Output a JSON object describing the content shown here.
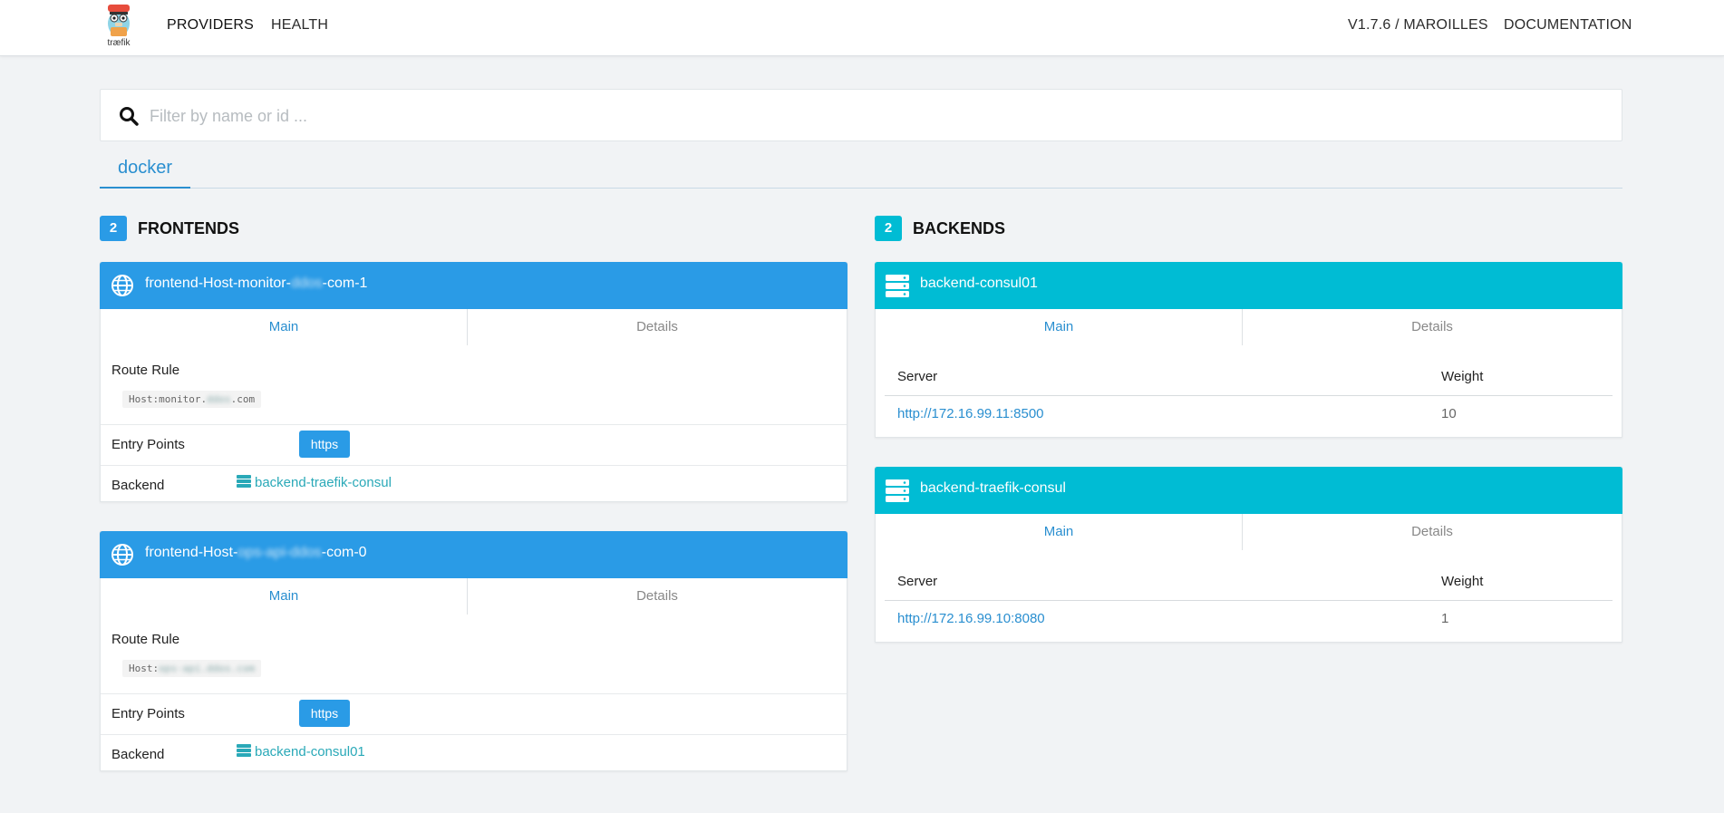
{
  "nav": {
    "logo_text": "træfik",
    "providers": "PROVIDERS",
    "health": "HEALTH",
    "version": "V1.7.6 / MAROILLES",
    "documentation": "DOCUMENTATION"
  },
  "search": {
    "placeholder": "Filter by name or id ...",
    "value": ""
  },
  "provider_tabs": [
    {
      "label": "docker"
    }
  ],
  "colors": {
    "frontend_header": "#2a9be6",
    "backend_header": "#00bcd4",
    "accent": "#2a8fd0"
  },
  "frontends": {
    "count": "2",
    "title": "FRONTENDS",
    "items": [
      {
        "name_prefix": "frontend-Host-monitor-",
        "name_masked": "ddos",
        "name_suffix": "-com-1",
        "tab_main": "Main",
        "tab_details": "Details",
        "route_rule_label": "Route Rule",
        "route_rule_prefix": "Host:monitor.",
        "route_rule_masked": "ddos",
        "route_rule_suffix": ".com",
        "entry_points_label": "Entry Points",
        "entry_point": "https",
        "backend_label": "Backend",
        "backend": "backend-traefik-consul"
      },
      {
        "name_prefix": "frontend-Host-",
        "name_masked": "ops-api-ddos",
        "name_suffix": "-com-0",
        "tab_main": "Main",
        "tab_details": "Details",
        "route_rule_label": "Route Rule",
        "route_rule_prefix": "Host:",
        "route_rule_masked": "ops-api.ddos.com",
        "route_rule_suffix": "",
        "entry_points_label": "Entry Points",
        "entry_point": "https",
        "backend_label": "Backend",
        "backend": "backend-consul01"
      }
    ]
  },
  "backends": {
    "count": "2",
    "title": "BACKENDS",
    "items": [
      {
        "name": "backend-consul01",
        "tab_main": "Main",
        "tab_details": "Details",
        "col_server": "Server",
        "col_weight": "Weight",
        "server": "http://172.16.99.11:8500",
        "weight": "10"
      },
      {
        "name": "backend-traefik-consul",
        "tab_main": "Main",
        "tab_details": "Details",
        "col_server": "Server",
        "col_weight": "Weight",
        "server": "http://172.16.99.10:8080",
        "weight": "1"
      }
    ]
  }
}
